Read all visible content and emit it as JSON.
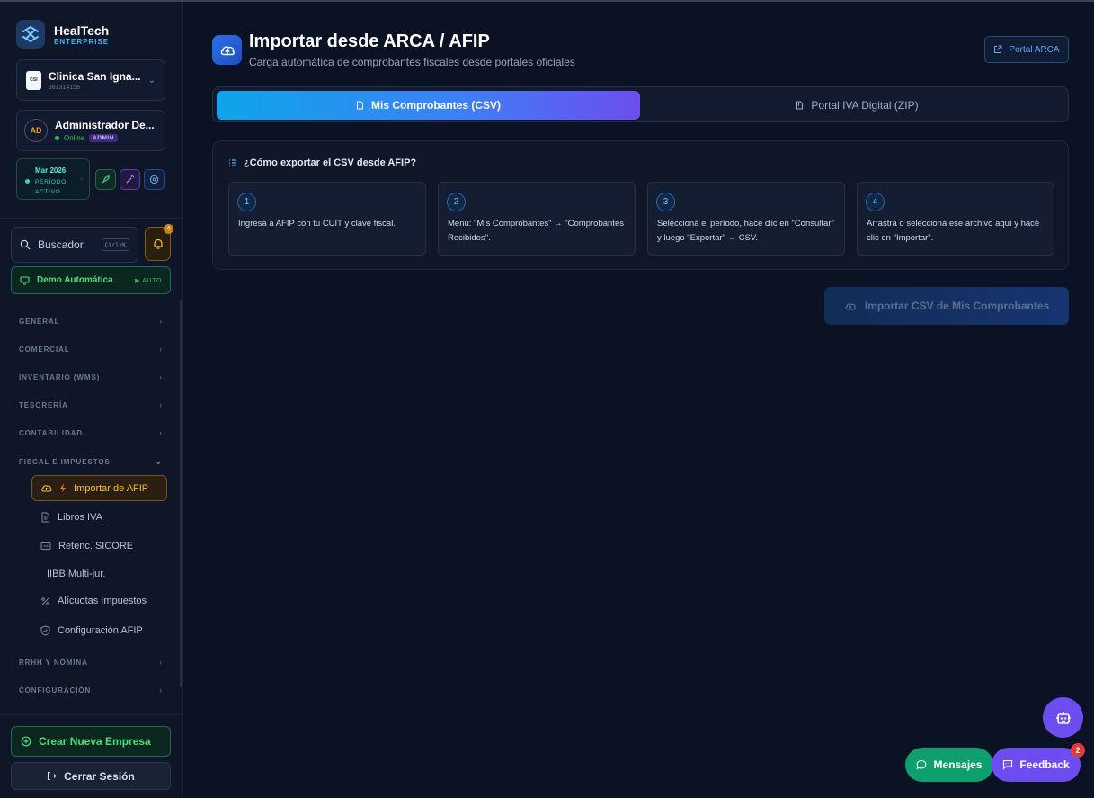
{
  "brand": {
    "name": "HealTech",
    "edition": "ENTERPRISE"
  },
  "company": {
    "name": "Clinica San Igna...",
    "id": "381314158",
    "logo_text": "CSI"
  },
  "user": {
    "initials": "AD",
    "name": "Administrador De...",
    "status": "Online",
    "role": "ADMIN"
  },
  "period": {
    "month": "Mar 2026",
    "label": "PERÍODO ACTIVO"
  },
  "search": {
    "label": "Buscador",
    "shortcut": "Ctrl+K"
  },
  "notifications": {
    "count": "4"
  },
  "demo": {
    "label": "Demo Automática",
    "mode": "▶ AUTO"
  },
  "nav": {
    "sections": [
      {
        "label": "GENERAL"
      },
      {
        "label": "COMERCIAL"
      },
      {
        "label": "INVENTARIO (WMS)"
      },
      {
        "label": "TESORERÍA"
      },
      {
        "label": "CONTABILIDAD"
      },
      {
        "label": "FISCAL E IMPUESTOS"
      },
      {
        "label": "RRHH Y NÓMINA"
      },
      {
        "label": "CONFIGURACIÓN"
      }
    ],
    "fiscal_items": [
      {
        "label": "Importar de AFIP"
      },
      {
        "label": "Libros IVA"
      },
      {
        "label": "Retenc. SICORE"
      },
      {
        "label": "IIBB Multi-jur."
      },
      {
        "label": "Alícuotas Impuestos"
      },
      {
        "label": "Configuración AFIP"
      }
    ]
  },
  "sidebar_footer": {
    "new_company": "Crear Nueva Empresa",
    "logout": "Cerrar Sesión"
  },
  "page": {
    "title": "Importar desde ARCA / AFIP",
    "subtitle": "Carga automática de comprobantes fiscales desde portales oficiales",
    "portal_button": "Portal ARCA"
  },
  "tabs": [
    {
      "label": "Mis Comprobantes (CSV)",
      "active": true
    },
    {
      "label": "Portal IVA Digital (ZIP)",
      "active": false
    }
  ],
  "howto": {
    "title": "¿Cómo exportar el CSV desde AFIP?",
    "steps": [
      {
        "num": "1",
        "text": "Ingresá a AFIP con tu CUIT y clave fiscal."
      },
      {
        "num": "2",
        "text": "Menú: \"Mis Comprobantes\" → \"Comprobantes Recibidos\"."
      },
      {
        "num": "3",
        "text": "Seleccioná el período, hacé clic en \"Consultar\" y luego \"Exportar\" → CSV."
      },
      {
        "num": "4",
        "text": "Arrastrá o seleccioná ese archivo aquí y hacé clic en \"Importar\"."
      }
    ]
  },
  "import_button": "Importar CSV de Mis Comprobantes",
  "floating": {
    "messages": "Mensajes",
    "feedback": "Feedback",
    "feedback_count": "2"
  },
  "colors": {
    "accent": "#3b82f6",
    "active_item": "#fbbf24",
    "success": "#4ade80",
    "purple": "#6d4df0"
  }
}
